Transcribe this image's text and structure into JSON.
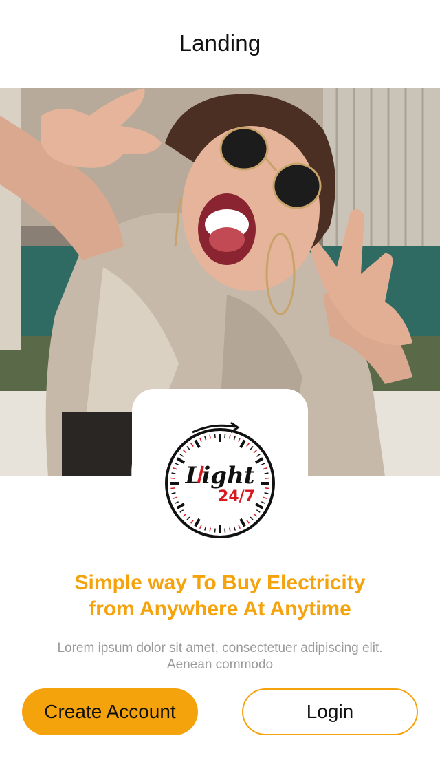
{
  "nav": {
    "title": "Landing"
  },
  "logo": {
    "word": "Light",
    "hours": "24/7"
  },
  "hero": {
    "headline_line1": "Simple way To Buy Electricity",
    "headline_line2": "from Anywhere At Anytime",
    "description": "Lorem ipsum dolor sit amet, consectetuer adipiscing elit. Aenean commodo"
  },
  "actions": {
    "create_account_label": "Create Account",
    "login_label": "Login"
  },
  "colors": {
    "accent": "#f5a30c",
    "logo_red": "#d71920",
    "text_dark": "#111111",
    "text_muted": "#9a9a9a"
  }
}
